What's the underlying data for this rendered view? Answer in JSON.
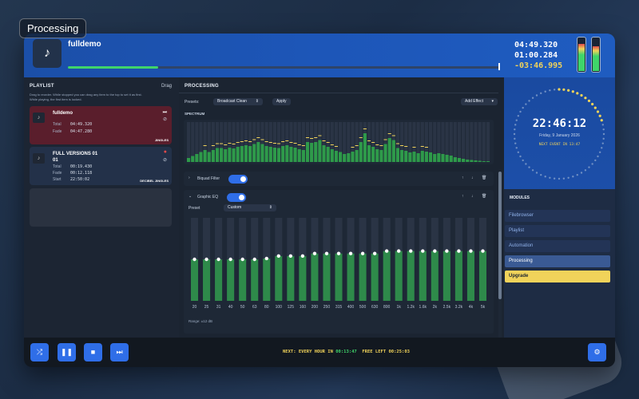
{
  "badge": "Processing",
  "now_playing": {
    "title": "fulldemo",
    "progress": 0.21,
    "times": {
      "elapsed": "04:49.320",
      "cue": "01:00.284",
      "remaining": "-03:46.995"
    }
  },
  "vu_levels": {
    "left": 0.78,
    "right": 0.72
  },
  "playlist": {
    "heading": "PLAYLIST",
    "drag_label": "Drag",
    "hint_line1": "Drag to reorder. While stopped you can drag any item to the top to set it as first.",
    "hint_line2": "While playing, the first item is locked.",
    "items": [
      {
        "title": "fulldemo",
        "total_label": "Total",
        "total": "04:49.320",
        "fade_label": "Fade",
        "fade": "04:47.280",
        "tag": "JINGLES"
      },
      {
        "title_line1": "FULL VERSIONS 01",
        "title_line2": "01",
        "total_label": "Total",
        "total": "00:19.430",
        "fade_label": "Fade",
        "fade": "00:12.118",
        "start_label": "Start",
        "start": "22:50:02",
        "tag": "DECIBEL JINGLES"
      }
    ]
  },
  "processing": {
    "heading": "PROCESSING",
    "presets_label": "Presets:",
    "preset_value": "Broadcast Clean",
    "apply_label": "Apply",
    "add_effect_label": "Add Effect",
    "spectrum_label": "SPECTRUM",
    "effects": [
      {
        "name": "Biquad Filter",
        "enabled": true,
        "expanded": false
      },
      {
        "name": "Graphic EQ",
        "enabled": true,
        "expanded": true
      }
    ],
    "eq": {
      "preset_label": "Preset",
      "preset_value": "Custom",
      "range_label": "Range: ±12 dB",
      "bands": [
        "20",
        "25",
        "31",
        "40",
        "50",
        "63",
        "80",
        "100",
        "125",
        "160",
        "200",
        "250",
        "315",
        "400",
        "500",
        "630",
        "800",
        "1k",
        "1.2k",
        "1.6k",
        "2k",
        "2.5k",
        "3.2k",
        "4k",
        "5k"
      ],
      "levels": [
        0.5,
        0.5,
        0.5,
        0.5,
        0.5,
        0.5,
        0.51,
        0.54,
        0.54,
        0.54,
        0.57,
        0.57,
        0.57,
        0.57,
        0.57,
        0.57,
        0.6,
        0.6,
        0.6,
        0.6,
        0.6,
        0.6,
        0.6,
        0.6,
        0.6
      ]
    },
    "spectrum": {
      "levels": [
        0.1,
        0.15,
        0.2,
        0.25,
        0.3,
        0.25,
        0.3,
        0.35,
        0.35,
        0.32,
        0.36,
        0.34,
        0.38,
        0.4,
        0.42,
        0.4,
        0.45,
        0.5,
        0.45,
        0.4,
        0.38,
        0.36,
        0.35,
        0.4,
        0.42,
        0.38,
        0.36,
        0.32,
        0.3,
        0.5,
        0.48,
        0.5,
        0.55,
        0.42,
        0.38,
        0.32,
        0.28,
        0.25,
        0.2,
        0.22,
        0.26,
        0.3,
        0.5,
        0.72,
        0.42,
        0.38,
        0.32,
        0.3,
        0.45,
        0.6,
        0.55,
        0.35,
        0.3,
        0.28,
        0.24,
        0.26,
        0.22,
        0.28,
        0.26,
        0.24,
        0.2,
        0.22,
        0.2,
        0.18,
        0.16,
        0.12,
        0.1,
        0.08,
        0.06,
        0.05,
        0.04,
        0.03,
        0.02,
        0.02
      ],
      "peak_color": "#f1d35a",
      "bar_color": "#2e9a4a"
    }
  },
  "clock": {
    "time": "22:46:12",
    "date": "Friday, 9 January 2026",
    "next_event": "NEXT EVENT IN 13:47"
  },
  "modules": {
    "heading": "MODULES",
    "items": [
      "Filebrowser",
      "Playlist",
      "Automation",
      "Processing",
      "Upgrade"
    ],
    "active": "Processing",
    "highlight": "Upgrade"
  },
  "footer": {
    "next_label": "NEXT: EVERY HOUR IN",
    "next_time": "00:13:47",
    "free_label": "FREE LEFT",
    "free_time": "00:25:03"
  },
  "colors": {
    "accent": "#2f6ee8",
    "green": "#3fd56a",
    "yellow": "#f1d35a",
    "header": "#1d56b8"
  }
}
